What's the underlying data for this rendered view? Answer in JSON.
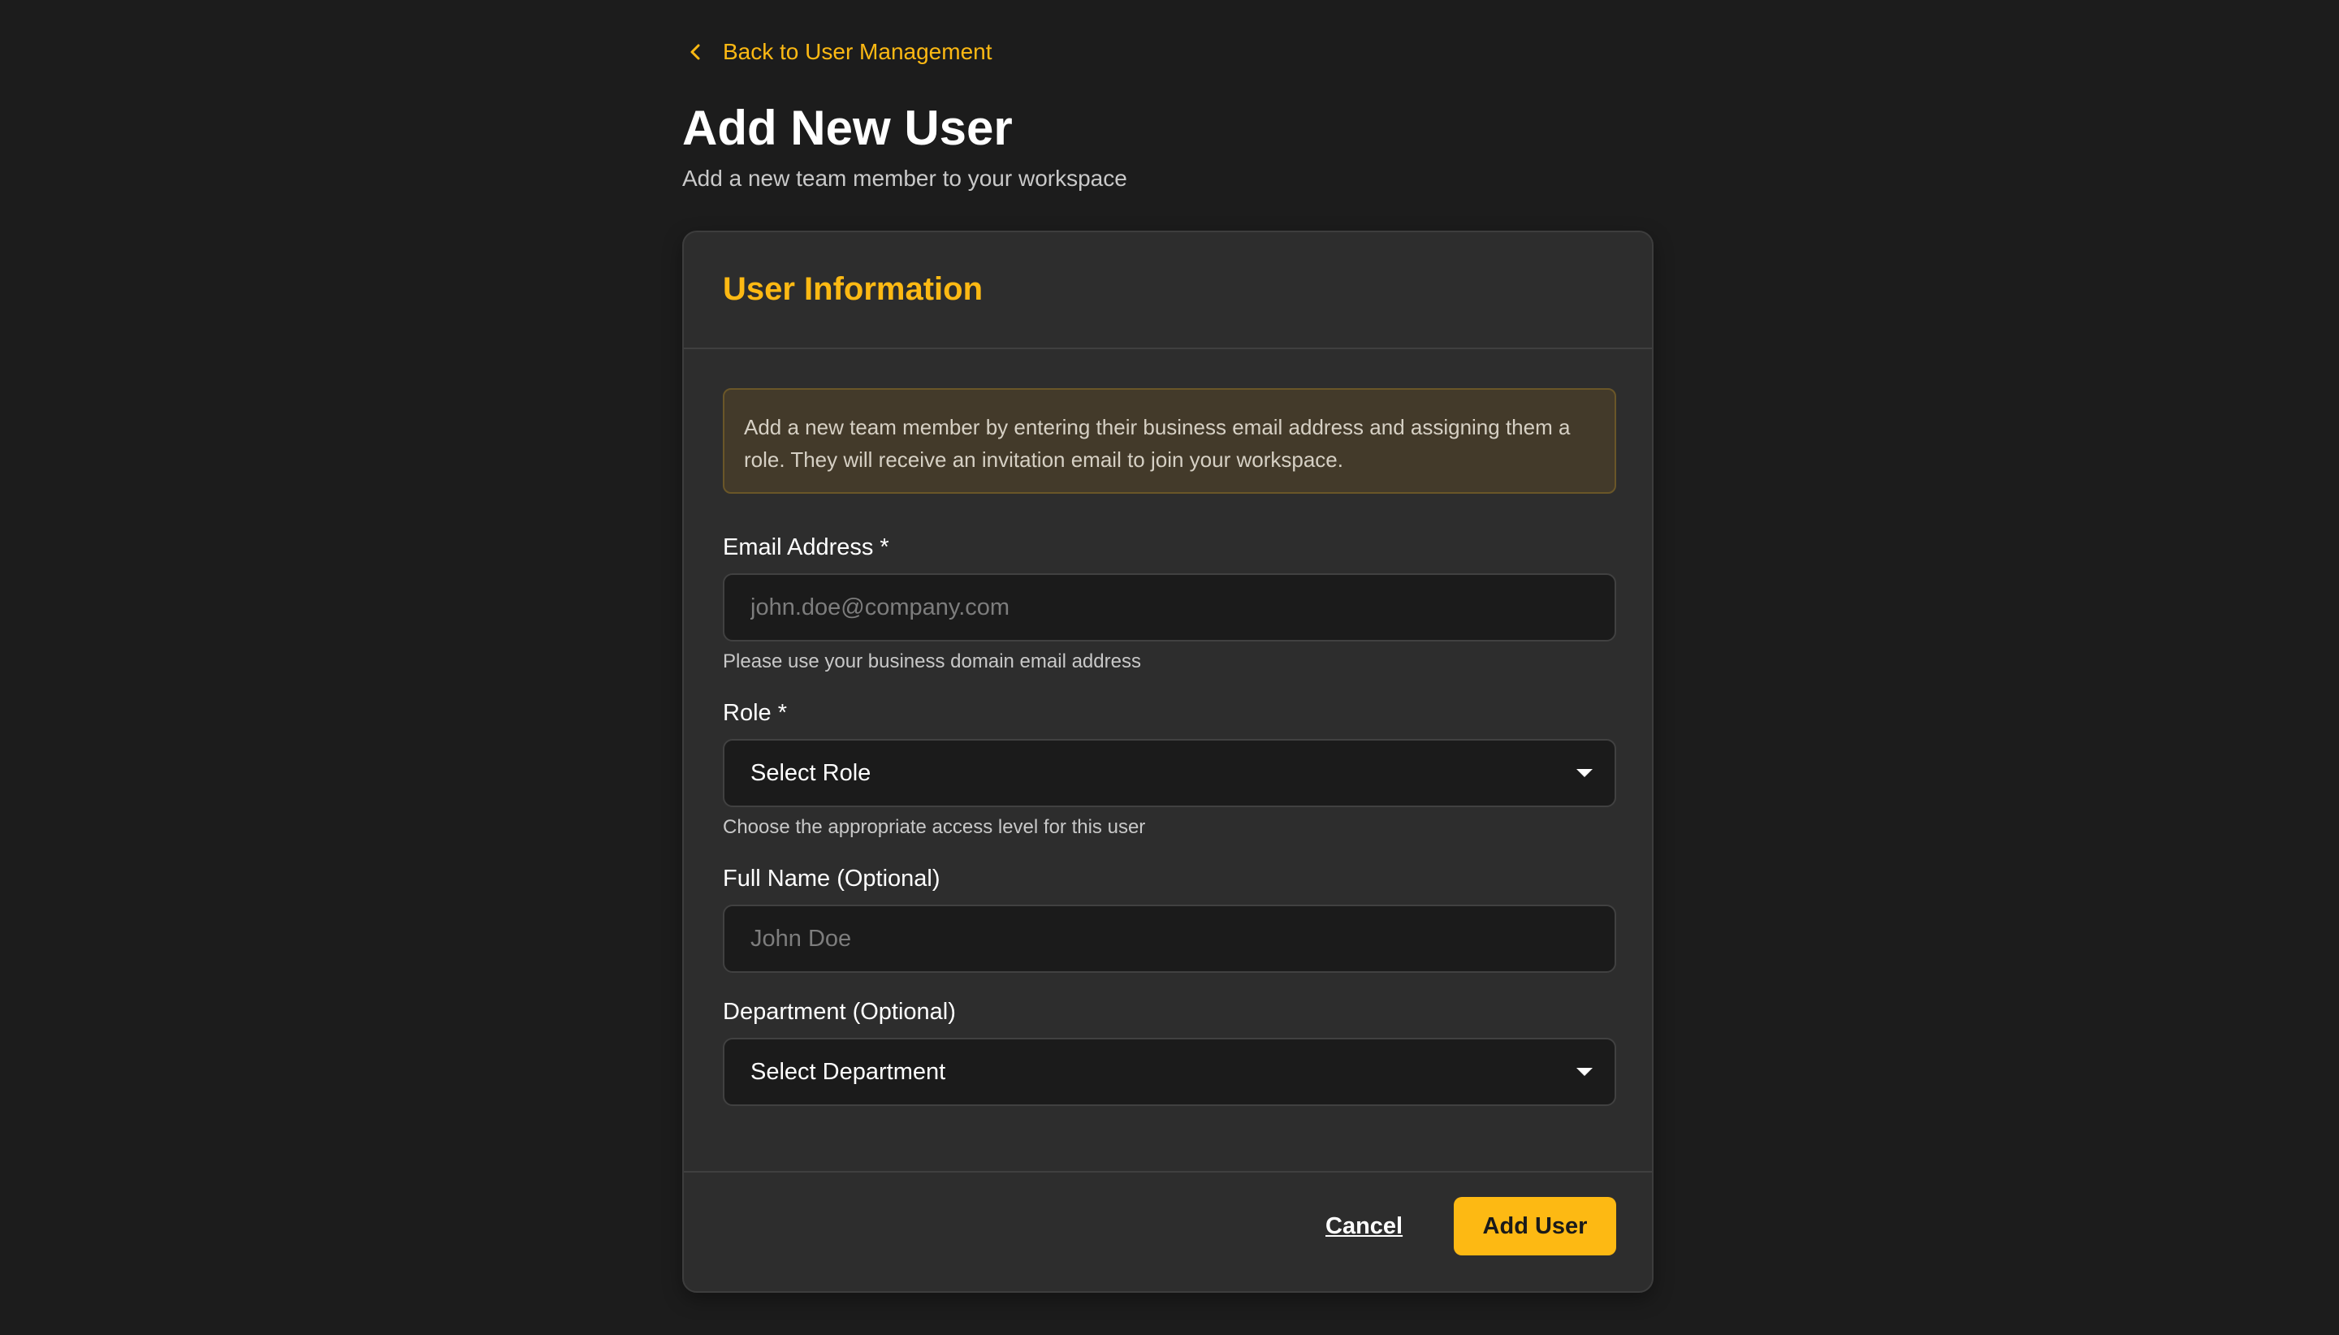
{
  "nav": {
    "back_label": "Back to User Management"
  },
  "header": {
    "title": "Add New User",
    "subtitle": "Add a new team member to your workspace"
  },
  "card": {
    "title": "User Information",
    "info_text": "Add a new team member by entering their business email address and assigning them a role. They will receive an invitation email to join your workspace."
  },
  "form": {
    "email": {
      "label": "Email Address *",
      "placeholder": "john.doe@company.com",
      "value": "",
      "helper": "Please use your business domain email address"
    },
    "role": {
      "label": "Role *",
      "selected": "Select Role",
      "helper": "Choose the appropriate access level for this user"
    },
    "full_name": {
      "label": "Full Name (Optional)",
      "placeholder": "John Doe",
      "value": ""
    },
    "department": {
      "label": "Department (Optional)",
      "selected": "Select Department"
    }
  },
  "actions": {
    "cancel_label": "Cancel",
    "submit_label": "Add User"
  },
  "icons": {
    "back": "chevron-left-icon",
    "select_caret": "caret-down-icon"
  },
  "colors": {
    "accent": "#fdb913",
    "background": "#1c1c1c",
    "card": "#2d2d2d",
    "info_bg": "#433a2a"
  }
}
